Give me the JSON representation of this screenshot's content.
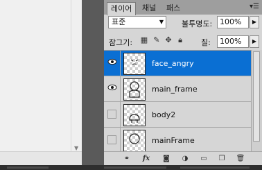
{
  "tabs": [
    "레이어",
    "채널",
    "패스"
  ],
  "blend_mode": "표준",
  "opacity_label": "불투명도:",
  "opacity_value": "100%",
  "lock_label": "잠그기:",
  "fill_label": "칠:",
  "fill_value": "100%",
  "layers": [
    {
      "name": "face_angry",
      "visible": true,
      "selected": true
    },
    {
      "name": "main_frame",
      "visible": true,
      "selected": false
    },
    {
      "name": "body2",
      "visible": false,
      "selected": false
    },
    {
      "name": "mainFrame",
      "visible": false,
      "selected": false
    }
  ],
  "icons": {
    "panel_menu": "panel-menu-icon",
    "lock_transparent": "lock-transparent-icon",
    "lock_paint": "brush-icon",
    "lock_move": "move-icon",
    "lock_all": "padlock-icon",
    "bottom": [
      "link-icon",
      "fx-icon",
      "mask-icon",
      "adjustment-icon",
      "group-folder-icon",
      "new-layer-icon",
      "trash-icon"
    ]
  },
  "colors": {
    "selection": "#0a6fd3",
    "panel": "#d6d6d6"
  }
}
